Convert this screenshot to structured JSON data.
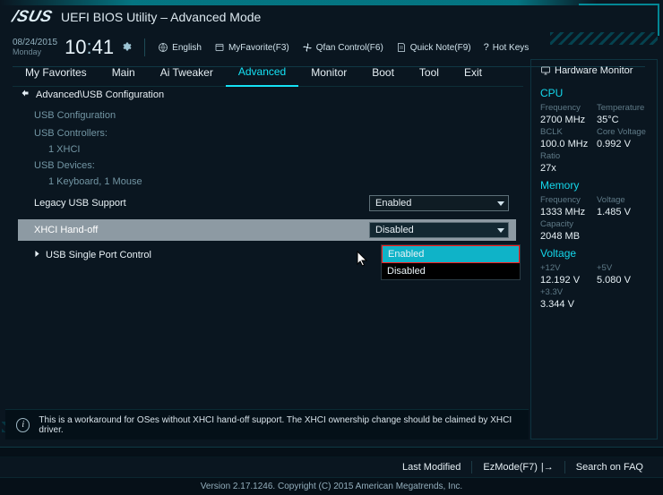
{
  "brand": {
    "logo_text": "/SUS",
    "app_title": "UEFI BIOS Utility – Advanced Mode"
  },
  "info": {
    "date": "08/24/2015",
    "day": "Monday",
    "clock_h": "10",
    "clock_m": "41",
    "lang": "English",
    "myfavorite": "MyFavorite(F3)",
    "qfan": "Qfan Control(F6)",
    "quicknote": "Quick Note(F9)",
    "hotkeys": "Hot Keys"
  },
  "tabs": [
    "My Favorites",
    "Main",
    "Ai Tweaker",
    "Advanced",
    "Monitor",
    "Boot",
    "Tool",
    "Exit"
  ],
  "active_tab_index": 3,
  "breadcrumb": "Advanced\\USB Configuration",
  "section": {
    "title": "USB Configuration",
    "controllers_label": "USB Controllers:",
    "controllers_value": "1 XHCI",
    "devices_label": "USB Devices:",
    "devices_value": "1 Keyboard, 1 Mouse"
  },
  "settings": {
    "legacy": {
      "label": "Legacy USB Support",
      "value": "Enabled"
    },
    "xhci": {
      "label": "XHCI Hand-off",
      "value": "Disabled"
    },
    "options": [
      "Enabled",
      "Disabled"
    ],
    "usb_ports_label": "USB Single Port Control"
  },
  "help_text": "This is a workaround for OSes without XHCI hand-off support. The XHCI ownership change should be claimed by XHCI driver.",
  "hw": {
    "title": "Hardware Monitor",
    "cpu": {
      "title": "CPU",
      "rows": [
        {
          "l": "Frequency",
          "v": "2700 MHz"
        },
        {
          "l": "Temperature",
          "v": "35°C"
        },
        {
          "l": "BCLK",
          "v": "100.0 MHz"
        },
        {
          "l": "Core Voltage",
          "v": "0.992 V"
        },
        {
          "l": "Ratio",
          "v": "27x"
        }
      ]
    },
    "mem": {
      "title": "Memory",
      "rows": [
        {
          "l": "Frequency",
          "v": "1333 MHz"
        },
        {
          "l": "Voltage",
          "v": "1.485 V"
        },
        {
          "l": "Capacity",
          "v": "2048 MB"
        }
      ]
    },
    "volt": {
      "title": "Voltage",
      "rows": [
        {
          "l": "+12V",
          "v": "12.192 V"
        },
        {
          "l": "+5V",
          "v": "5.080 V"
        },
        {
          "l": "+3.3V",
          "v": "3.344 V"
        }
      ]
    }
  },
  "footer": {
    "lastmod": "Last Modified",
    "ezmode": "EzMode(F7)",
    "search": "Search on FAQ",
    "version": "Version 2.17.1246. Copyright (C) 2015 American Megatrends, Inc."
  }
}
